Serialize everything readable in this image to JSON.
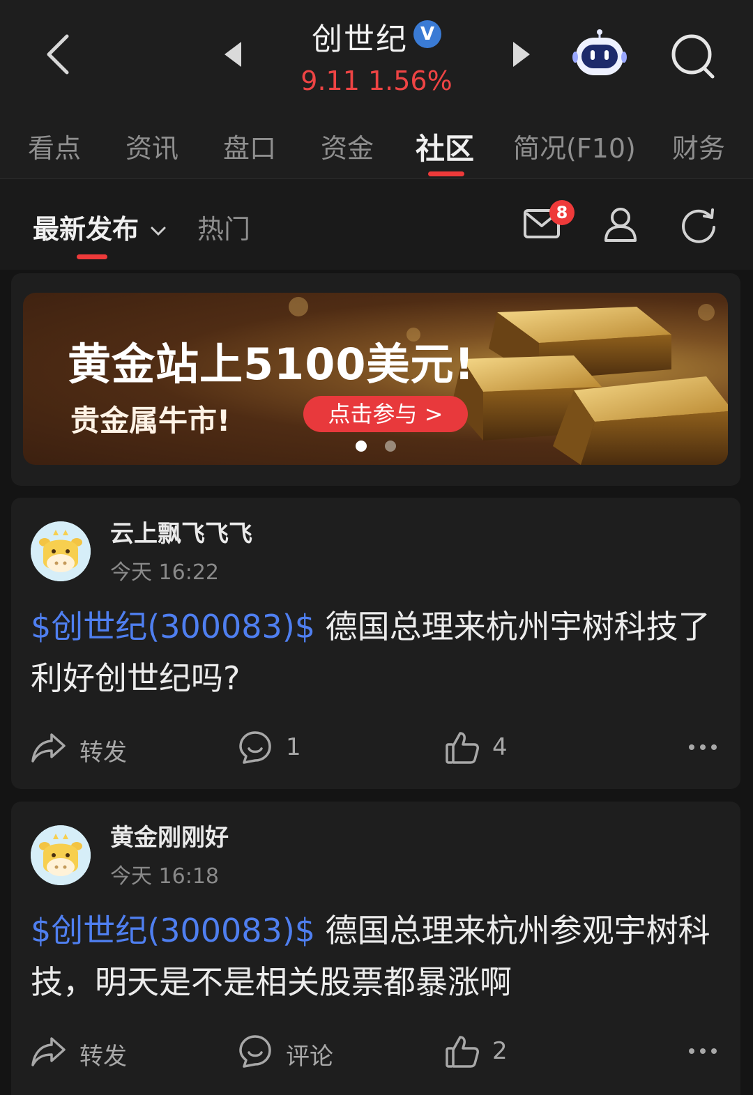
{
  "header": {
    "stock_name": "创世纪",
    "verified_badge": "V",
    "price": "9.11",
    "change_pct": "1.56%",
    "colors": {
      "up": "#ee4444",
      "accent": "#ee3a3a",
      "link": "#4f7ff0"
    }
  },
  "tabs": [
    "看点",
    "资讯",
    "盘口",
    "资金",
    "社区",
    "简况(F10)",
    "财务"
  ],
  "active_tab": "社区",
  "subheader": {
    "latest": "最新发布",
    "hot": "热门",
    "message_count": "8"
  },
  "banner": {
    "title": "黄金站上5100美元!",
    "subtitle": "贵金属牛市!",
    "button": "点击参与 >"
  },
  "posts": [
    {
      "username": "云上飘飞飞飞",
      "time": "今天 16:22",
      "tag": "$创世纪(300083)$",
      "text": " 德国总理来杭州宇树科技了 利好创世纪吗?",
      "forward_label": "转发",
      "comment_label": "1",
      "like_count": "4"
    },
    {
      "username": "黄金刚刚好",
      "time": "今天 16:18",
      "tag": "$创世纪(300083)$",
      "text": " 德国总理来杭州参观宇树科技，明天是不是相关股票都暴涨啊",
      "forward_label": "转发",
      "comment_label": "评论",
      "like_count": "2"
    }
  ]
}
